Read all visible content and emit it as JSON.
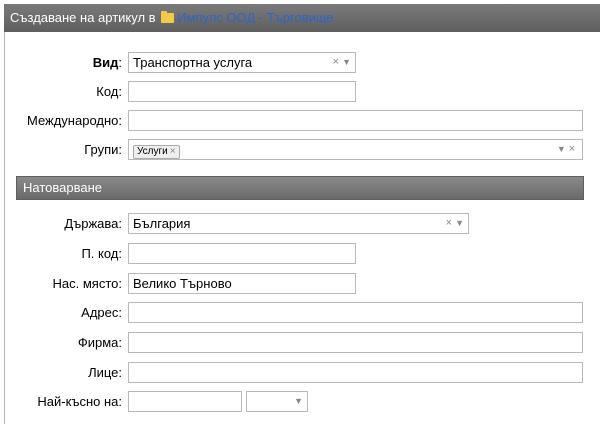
{
  "window": {
    "title_prefix": "Създаване на артикул в",
    "folder_link": "Импулс ООД - Търговище"
  },
  "form": {
    "vid": {
      "label": "Вид",
      "value": "Транспортна услуга"
    },
    "kod": {
      "label": "Код:",
      "value": ""
    },
    "mezhdunarodno": {
      "label": "Международно:",
      "value": ""
    },
    "grupi": {
      "label": "Групи:",
      "tag": "Услуги"
    }
  },
  "section": {
    "title": "Натоварване"
  },
  "loading": {
    "durzhava": {
      "label": "Държава:",
      "value": "България"
    },
    "p_kod": {
      "label": "П. код:",
      "value": ""
    },
    "nas_myasto": {
      "label": "Нас. място:",
      "value": "Велико Търново"
    },
    "adres": {
      "label": "Адрес:",
      "value": ""
    },
    "firma": {
      "label": "Фирма:",
      "value": ""
    },
    "litse": {
      "label": "Лице:",
      "value": ""
    },
    "nay_kasno": {
      "label": "Най-късно на:",
      "date_value": "",
      "time_value": ""
    }
  },
  "icons": {
    "folder": "folder-icon",
    "clear": "×",
    "dropdown": "▼"
  }
}
